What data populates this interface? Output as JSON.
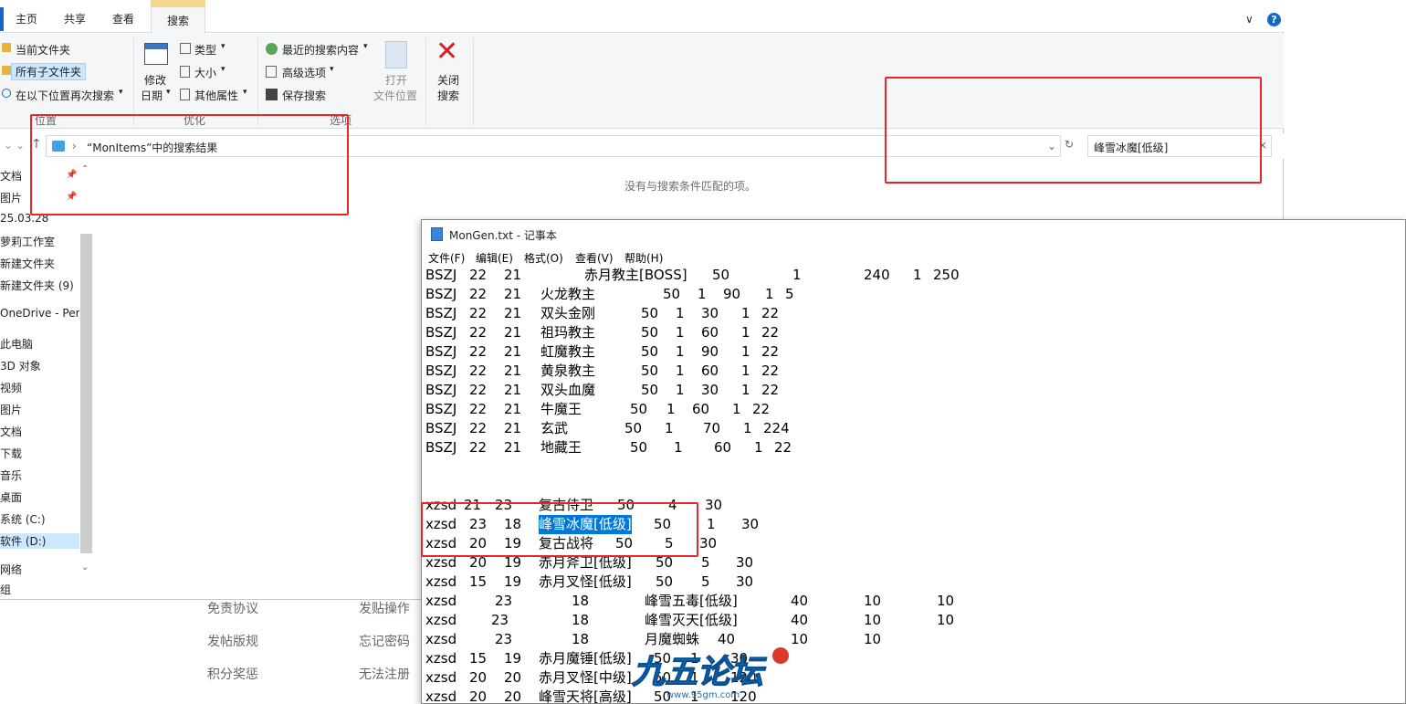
{
  "web": {
    "links": [
      "免责协议",
      "发贴操作",
      "发帖版规",
      "忘记密码",
      "积分奖惩",
      "无法注册"
    ]
  },
  "explorer": {
    "tabs": [
      "主页",
      "共享",
      "查看",
      "搜索"
    ],
    "ribbon": {
      "location": {
        "current_folder": "当前文件夹",
        "all_subfolders": "所有子文件夹",
        "search_again_in": "在以下位置再次搜索",
        "group_label": "位置"
      },
      "refine": {
        "date_modified_line1": "修改",
        "date_modified_line2": "日期",
        "type": "类型",
        "size": "大小",
        "other_properties": "其他属性",
        "group_label": "优化"
      },
      "options": {
        "recent_searches": "最近的搜索内容",
        "advanced_options": "高级选项",
        "save_search": "保存搜索",
        "open_file_location_line1": "打开",
        "open_file_location_line2": "文件位置",
        "close_search_line1": "关闭",
        "close_search_line2": "搜索",
        "group_label": "选项"
      }
    },
    "address": {
      "path": "“MonItems”中的搜索结果"
    },
    "search_box": {
      "value": "峰雪冰魔[低级]"
    },
    "nav_items": [
      "文档",
      "图片",
      "25.03.28",
      "萝莉工作室",
      "新建文件夹",
      "新建文件夹 (9)",
      "OneDrive - Perso",
      "此电脑",
      "3D 对象",
      "视频",
      "图片",
      "文档",
      "下载",
      "音乐",
      "桌面",
      "系统 (C:)",
      "软件 (D:)",
      "网络",
      "组"
    ],
    "empty_message": "没有与搜索条件匹配的项。",
    "colors": {
      "accent": "#1a66c7",
      "selection": "#cce8ff",
      "annotation": "#e8262a"
    }
  },
  "notepad": {
    "title": "MonGen.txt - 记事本",
    "menu": [
      "文件(F)",
      "编辑(E)",
      "格式(O)",
      "查看(V)",
      "帮助(H)"
    ],
    "lines": [
      [
        "BSZJ",
        "22",
        "21",
        "赤月教主[BOSS]",
        "50",
        "1",
        "240",
        "1",
        "250"
      ],
      [
        "BSZJ",
        "22",
        "21",
        "火龙教主",
        "50",
        "1",
        "90",
        "1",
        "5"
      ],
      [
        "BSZJ",
        "22",
        "21",
        "双头金刚",
        "50",
        "1",
        "30",
        "1",
        "22"
      ],
      [
        "BSZJ",
        "22",
        "21",
        "祖玛教主",
        "50",
        "1",
        "60",
        "1",
        "22"
      ],
      [
        "BSZJ",
        "22",
        "21",
        "虹魔教主",
        "50",
        "1",
        "90",
        "1",
        "22"
      ],
      [
        "BSZJ",
        "22",
        "21",
        "黄泉教主",
        "50",
        "1",
        "60",
        "1",
        "22"
      ],
      [
        "BSZJ",
        "22",
        "21",
        "双头血魔",
        "50",
        "1",
        "30",
        "1",
        "22"
      ],
      [
        "BSZJ",
        "22",
        "21",
        "牛魔王",
        "50",
        "1",
        "60",
        "1",
        "22"
      ],
      [
        "BSZJ",
        "22",
        "21",
        "玄武",
        "50",
        "1",
        "70",
        "1",
        "224"
      ],
      [
        "BSZJ",
        "22",
        "21",
        "地藏王",
        "50",
        "1",
        "60",
        "1",
        "22"
      ],
      [],
      [],
      [
        "xzsd",
        "21",
        "23",
        "复古侍卫",
        "50",
        "4",
        "30"
      ],
      [
        "xzsd",
        "23",
        "18",
        "峰雪冰魔[低级]",
        "50",
        "1",
        "30"
      ],
      [
        "xzsd",
        "20",
        "19",
        "复古战将",
        "50",
        "5",
        "30"
      ],
      [
        "xzsd",
        "20",
        "19",
        "赤月斧卫[低级]",
        "50",
        "5",
        "30"
      ],
      [
        "xzsd",
        "15",
        "19",
        "赤月叉怪[低级]",
        "50",
        "5",
        "30"
      ],
      [
        "xzsd",
        "23",
        "18",
        "峰雪五毒[低级]",
        "40",
        "10",
        "10"
      ],
      [
        "xzsd",
        "23",
        "18",
        "峰雪灭天[低级]",
        "40",
        "10",
        "10"
      ],
      [
        "xzsd",
        "23",
        "18",
        "月魔蜘蛛",
        "40",
        "10",
        "10"
      ],
      [
        "xzsd",
        "15",
        "19",
        "赤月魔锤[低级]",
        "50",
        "1",
        "30"
      ],
      [
        "xzsd",
        "20",
        "20",
        "赤月叉怪[中级]",
        "50",
        "1",
        "120"
      ],
      [
        "xzsd",
        "20",
        "20",
        "峰雪天将[高级]",
        "50",
        "1",
        "120"
      ]
    ],
    "selected_text": "峰雪冰魔[低级]"
  },
  "watermark": {
    "logo_text": "九五论坛",
    "url": "www.95gm.com"
  }
}
